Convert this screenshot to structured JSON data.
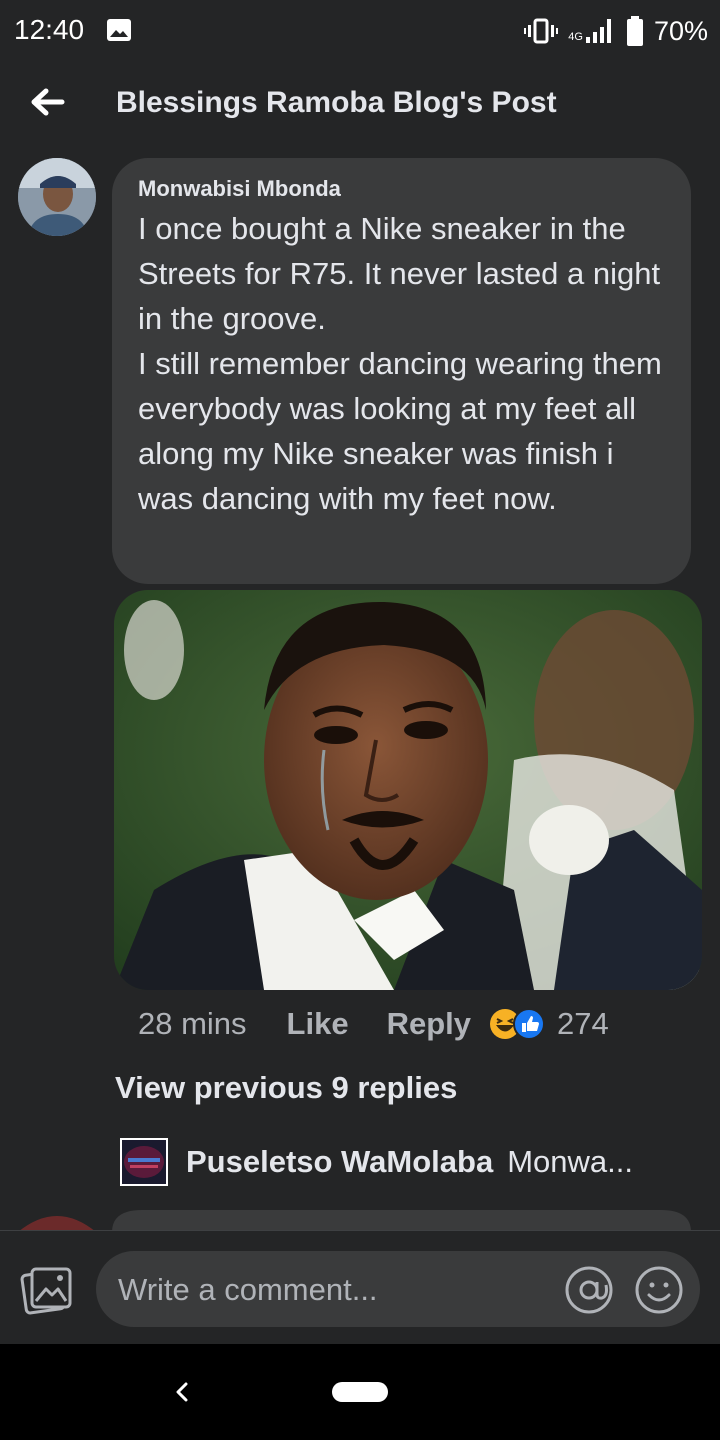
{
  "status_bar": {
    "time": "12:40",
    "network": "4G",
    "battery": "70%",
    "icons": [
      "image-icon",
      "vibrate-icon",
      "signal-icon",
      "battery-icon"
    ]
  },
  "header": {
    "title": "Blessings Ramoba Blog's Post",
    "back_icon": "arrow-left-icon"
  },
  "comment": {
    "author": "Monwabisi Mbonda",
    "text": "I once bought a Nike sneaker in the Streets for R75.  It never lasted a night in the groove.\nI still remember dancing wearing them everybody was looking at my feet all along my Nike sneaker was finish i was dancing with my feet now.",
    "time": "28 mins",
    "like_label": "Like",
    "reply_label": "Reply",
    "reaction_icons": [
      "haha-icon",
      "like-icon"
    ],
    "reaction_count": "274"
  },
  "replies": {
    "view_previous": "View previous 9 replies",
    "latest": {
      "author": "Puseletso WaMolaba",
      "preview": "Monwa..."
    }
  },
  "composer": {
    "placeholder": "Write a comment...",
    "icons": [
      "photo-icon",
      "at-icon",
      "emoji-icon"
    ]
  },
  "colors": {
    "background": "#242526",
    "bubble": "#3a3b3c",
    "text": "#e4e6eb",
    "secondary_text": "#b0b3b8",
    "like_blue": "#1877f2",
    "haha_yellow": "#f7b125"
  }
}
